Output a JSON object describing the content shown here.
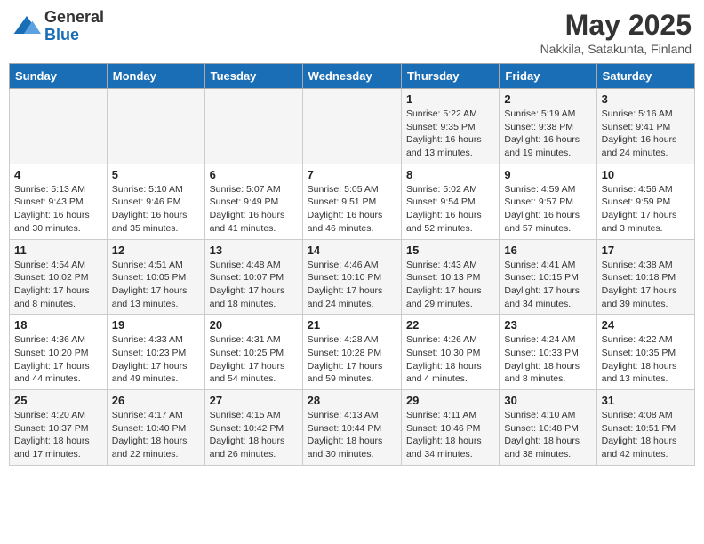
{
  "header": {
    "logo_general": "General",
    "logo_blue": "Blue",
    "month_title": "May 2025",
    "location": "Nakkila, Satakunta, Finland"
  },
  "weekdays": [
    "Sunday",
    "Monday",
    "Tuesday",
    "Wednesday",
    "Thursday",
    "Friday",
    "Saturday"
  ],
  "weeks": [
    [
      {
        "day": "",
        "info": ""
      },
      {
        "day": "",
        "info": ""
      },
      {
        "day": "",
        "info": ""
      },
      {
        "day": "",
        "info": ""
      },
      {
        "day": "1",
        "info": "Sunrise: 5:22 AM\nSunset: 9:35 PM\nDaylight: 16 hours\nand 13 minutes."
      },
      {
        "day": "2",
        "info": "Sunrise: 5:19 AM\nSunset: 9:38 PM\nDaylight: 16 hours\nand 19 minutes."
      },
      {
        "day": "3",
        "info": "Sunrise: 5:16 AM\nSunset: 9:41 PM\nDaylight: 16 hours\nand 24 minutes."
      }
    ],
    [
      {
        "day": "4",
        "info": "Sunrise: 5:13 AM\nSunset: 9:43 PM\nDaylight: 16 hours\nand 30 minutes."
      },
      {
        "day": "5",
        "info": "Sunrise: 5:10 AM\nSunset: 9:46 PM\nDaylight: 16 hours\nand 35 minutes."
      },
      {
        "day": "6",
        "info": "Sunrise: 5:07 AM\nSunset: 9:49 PM\nDaylight: 16 hours\nand 41 minutes."
      },
      {
        "day": "7",
        "info": "Sunrise: 5:05 AM\nSunset: 9:51 PM\nDaylight: 16 hours\nand 46 minutes."
      },
      {
        "day": "8",
        "info": "Sunrise: 5:02 AM\nSunset: 9:54 PM\nDaylight: 16 hours\nand 52 minutes."
      },
      {
        "day": "9",
        "info": "Sunrise: 4:59 AM\nSunset: 9:57 PM\nDaylight: 16 hours\nand 57 minutes."
      },
      {
        "day": "10",
        "info": "Sunrise: 4:56 AM\nSunset: 9:59 PM\nDaylight: 17 hours\nand 3 minutes."
      }
    ],
    [
      {
        "day": "11",
        "info": "Sunrise: 4:54 AM\nSunset: 10:02 PM\nDaylight: 17 hours\nand 8 minutes."
      },
      {
        "day": "12",
        "info": "Sunrise: 4:51 AM\nSunset: 10:05 PM\nDaylight: 17 hours\nand 13 minutes."
      },
      {
        "day": "13",
        "info": "Sunrise: 4:48 AM\nSunset: 10:07 PM\nDaylight: 17 hours\nand 18 minutes."
      },
      {
        "day": "14",
        "info": "Sunrise: 4:46 AM\nSunset: 10:10 PM\nDaylight: 17 hours\nand 24 minutes."
      },
      {
        "day": "15",
        "info": "Sunrise: 4:43 AM\nSunset: 10:13 PM\nDaylight: 17 hours\nand 29 minutes."
      },
      {
        "day": "16",
        "info": "Sunrise: 4:41 AM\nSunset: 10:15 PM\nDaylight: 17 hours\nand 34 minutes."
      },
      {
        "day": "17",
        "info": "Sunrise: 4:38 AM\nSunset: 10:18 PM\nDaylight: 17 hours\nand 39 minutes."
      }
    ],
    [
      {
        "day": "18",
        "info": "Sunrise: 4:36 AM\nSunset: 10:20 PM\nDaylight: 17 hours\nand 44 minutes."
      },
      {
        "day": "19",
        "info": "Sunrise: 4:33 AM\nSunset: 10:23 PM\nDaylight: 17 hours\nand 49 minutes."
      },
      {
        "day": "20",
        "info": "Sunrise: 4:31 AM\nSunset: 10:25 PM\nDaylight: 17 hours\nand 54 minutes."
      },
      {
        "day": "21",
        "info": "Sunrise: 4:28 AM\nSunset: 10:28 PM\nDaylight: 17 hours\nand 59 minutes."
      },
      {
        "day": "22",
        "info": "Sunrise: 4:26 AM\nSunset: 10:30 PM\nDaylight: 18 hours\nand 4 minutes."
      },
      {
        "day": "23",
        "info": "Sunrise: 4:24 AM\nSunset: 10:33 PM\nDaylight: 18 hours\nand 8 minutes."
      },
      {
        "day": "24",
        "info": "Sunrise: 4:22 AM\nSunset: 10:35 PM\nDaylight: 18 hours\nand 13 minutes."
      }
    ],
    [
      {
        "day": "25",
        "info": "Sunrise: 4:20 AM\nSunset: 10:37 PM\nDaylight: 18 hours\nand 17 minutes."
      },
      {
        "day": "26",
        "info": "Sunrise: 4:17 AM\nSunset: 10:40 PM\nDaylight: 18 hours\nand 22 minutes."
      },
      {
        "day": "27",
        "info": "Sunrise: 4:15 AM\nSunset: 10:42 PM\nDaylight: 18 hours\nand 26 minutes."
      },
      {
        "day": "28",
        "info": "Sunrise: 4:13 AM\nSunset: 10:44 PM\nDaylight: 18 hours\nand 30 minutes."
      },
      {
        "day": "29",
        "info": "Sunrise: 4:11 AM\nSunset: 10:46 PM\nDaylight: 18 hours\nand 34 minutes."
      },
      {
        "day": "30",
        "info": "Sunrise: 4:10 AM\nSunset: 10:48 PM\nDaylight: 18 hours\nand 38 minutes."
      },
      {
        "day": "31",
        "info": "Sunrise: 4:08 AM\nSunset: 10:51 PM\nDaylight: 18 hours\nand 42 minutes."
      }
    ]
  ]
}
